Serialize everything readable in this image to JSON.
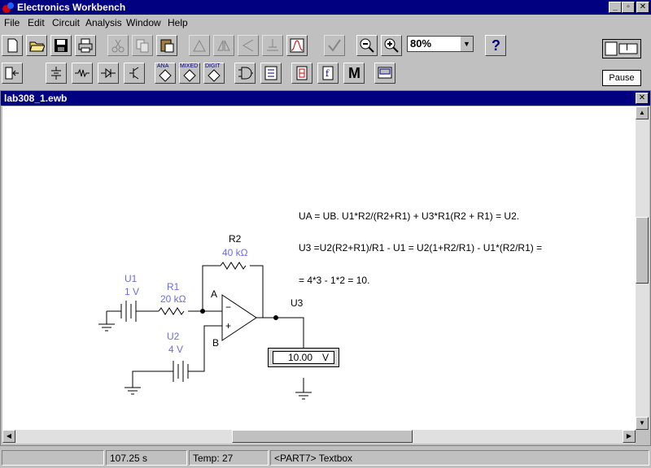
{
  "app": {
    "title": "Electronics Workbench",
    "controls": {
      "minimize": "_",
      "maximize": "▫",
      "close": "✕"
    }
  },
  "menu": [
    "File",
    "Edit",
    "Circuit",
    "Analysis",
    "Window",
    "Help"
  ],
  "toolbar": {
    "zoom": "80%",
    "help": "?",
    "pause": "Pause",
    "power": "I",
    "bins": {
      "analog": "ANA",
      "mixed": "MIXED",
      "digital": "DIGIT",
      "misc": "M"
    }
  },
  "document": {
    "title": "lab308_1.ewb",
    "close": "✕"
  },
  "circuit": {
    "r2": {
      "name": "R2",
      "value": "40 kΩ"
    },
    "r1": {
      "name": "R1",
      "value": "20 kΩ"
    },
    "u1": {
      "name": "U1",
      "value": "1 V"
    },
    "u2": {
      "name": "U2",
      "value": "4 V"
    },
    "node_a": "A",
    "node_b": "B",
    "out": "U3",
    "meter_value": "10.00",
    "meter_unit": "V"
  },
  "equations": [
    "UA = UB. U1*R2/(R2+R1) + U3*R1(R2 + R1) = U2.",
    "U3 =U2(R2+R1)/R1 - U1 = U2(1+R2/R1) - U1*(R2/R1) =",
    "= 4*3 - 1*2 = 10."
  ],
  "status": {
    "time": "107.25 s",
    "temp": "Temp:  27",
    "part": "<PART7> Textbox"
  },
  "colors": {
    "titlebar": "#000080",
    "component_label": "#6c6cd8"
  }
}
